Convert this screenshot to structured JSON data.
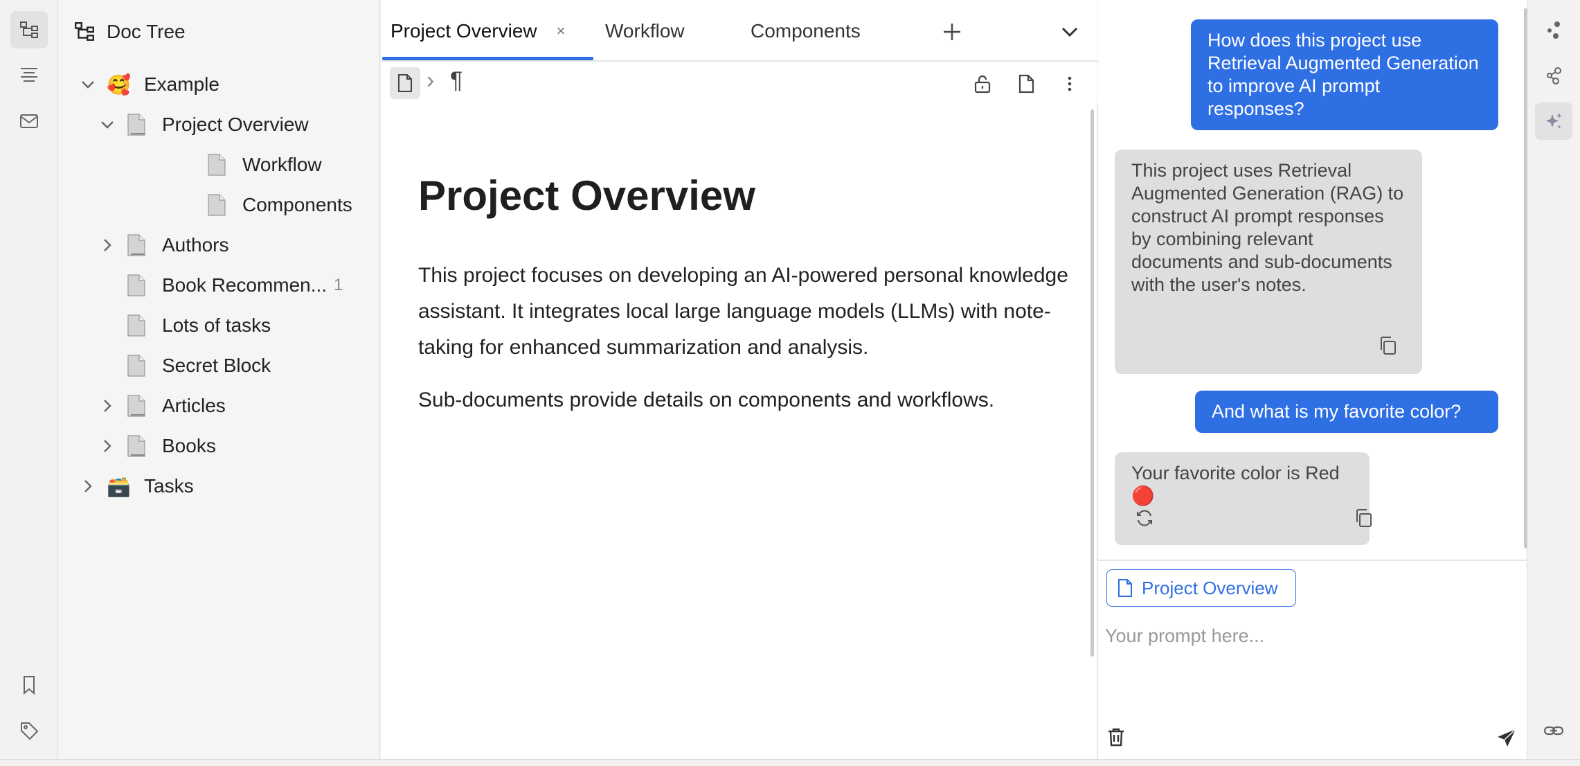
{
  "sidebar": {
    "title": "Doc Tree",
    "tree": [
      {
        "label": "Example",
        "emoji": "🥰",
        "expanded": true,
        "level": 0
      },
      {
        "label": "Project Overview",
        "expanded": true,
        "level": 1
      },
      {
        "label": "Workflow",
        "level": 2
      },
      {
        "label": "Components",
        "level": 2
      },
      {
        "label": "Authors",
        "expanded": false,
        "level": 1
      },
      {
        "label": "Book Recommen...",
        "count": "1",
        "level": 1
      },
      {
        "label": "Lots of tasks",
        "level": 1
      },
      {
        "label": "Secret Block",
        "level": 1
      },
      {
        "label": "Articles",
        "expanded": false,
        "level": 1
      },
      {
        "label": "Books",
        "expanded": false,
        "level": 1
      },
      {
        "label": "Tasks",
        "emoji": "🗃️",
        "expanded": false,
        "level": 0
      }
    ]
  },
  "tabs": [
    {
      "label": "Project Overview",
      "active": true,
      "close": "×"
    },
    {
      "label": "Workflow",
      "active": false
    },
    {
      "label": "Components",
      "active": false
    }
  ],
  "breadcrumb": {
    "separator": "›",
    "block_icon": "¶"
  },
  "document": {
    "title": "Project Overview",
    "paragraphs": [
      "This project focuses on developing an AI-powered personal knowledge assistant. It integrates local large language models (LLMs) with note-taking for enhanced summarization and analysis.",
      "Sub-documents provide details on components and workflows."
    ]
  },
  "chat": {
    "messages": [
      {
        "role": "user",
        "text": "How does this project use Retrieval Augmented Generation to improve AI prompt responses?"
      },
      {
        "role": "assistant",
        "text": "This project uses Retrieval Augmented Generation (RAG) to construct AI prompt responses by combining relevant documents and sub-documents with the user's notes."
      },
      {
        "role": "user",
        "text": "And what is my favorite color?"
      },
      {
        "role": "assistant",
        "text": "Your favorite color is Red 🔴"
      }
    ],
    "context_chip": "Project Overview",
    "prompt_placeholder": "Your prompt here...",
    "prompt_value": ""
  },
  "colors": {
    "accent": "#2f6fe4",
    "assistant_bubble": "#dedede"
  },
  "icons": {
    "left_dock": [
      "doc-tree-icon",
      "outline-icon",
      "inbox-icon",
      "bookmark-icon",
      "tag-icon"
    ],
    "right_dock": [
      "graph-icon",
      "global-graph-icon",
      "ai-sparkle-icon",
      "backlink-icon"
    ]
  }
}
